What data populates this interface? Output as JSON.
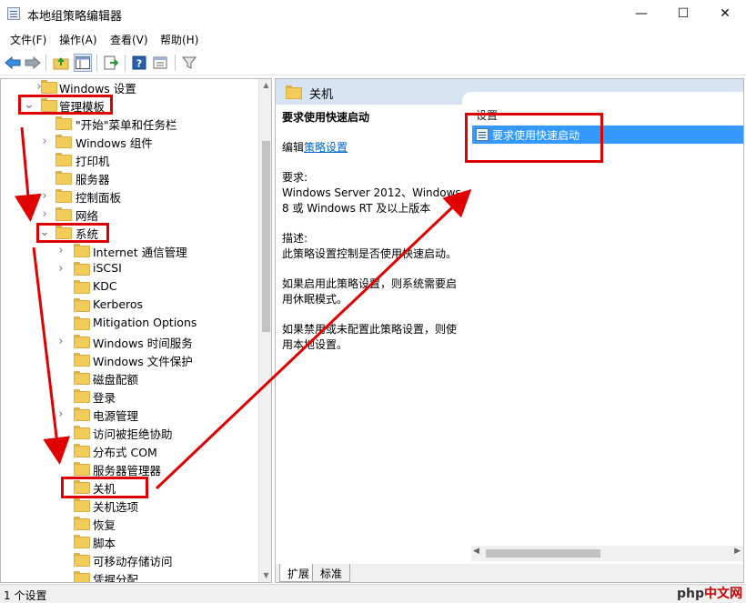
{
  "window": {
    "title": "本地组策略编辑器",
    "min_glyph": "—",
    "max_glyph": "☐",
    "close_glyph": "✕"
  },
  "menu": [
    "文件(F)",
    "操作(A)",
    "查看(V)",
    "帮助(H)"
  ],
  "toolbar_icons": [
    "back-arrow-icon",
    "forward-arrow-icon",
    "up-folder-icon",
    "show-hide-tree-icon",
    "export-list-icon",
    "help-icon",
    "properties-icon",
    "filter-icon"
  ],
  "tree": [
    {
      "label": "Windows 设置",
      "depth": 0,
      "expander": "closed"
    },
    {
      "label": "管理模板",
      "depth": 0,
      "expander": "open"
    },
    {
      "label": "\"开始\"菜单和任务栏",
      "depth": 1,
      "expander": "none"
    },
    {
      "label": "Windows 组件",
      "depth": 1,
      "expander": "closed"
    },
    {
      "label": "打印机",
      "depth": 1,
      "expander": "none"
    },
    {
      "label": "服务器",
      "depth": 1,
      "expander": "none"
    },
    {
      "label": "控制面板",
      "depth": 1,
      "expander": "closed"
    },
    {
      "label": "网络",
      "depth": 1,
      "expander": "closed"
    },
    {
      "label": "系统",
      "depth": 1,
      "expander": "open"
    },
    {
      "label": "Internet 通信管理",
      "depth": 2,
      "expander": "closed"
    },
    {
      "label": "iSCSI",
      "depth": 2,
      "expander": "closed"
    },
    {
      "label": "KDC",
      "depth": 2,
      "expander": "none"
    },
    {
      "label": "Kerberos",
      "depth": 2,
      "expander": "none"
    },
    {
      "label": "Mitigation Options",
      "depth": 2,
      "expander": "none"
    },
    {
      "label": "Windows 时间服务",
      "depth": 2,
      "expander": "closed"
    },
    {
      "label": "Windows 文件保护",
      "depth": 2,
      "expander": "none"
    },
    {
      "label": "磁盘配额",
      "depth": 2,
      "expander": "none"
    },
    {
      "label": "登录",
      "depth": 2,
      "expander": "none"
    },
    {
      "label": "电源管理",
      "depth": 2,
      "expander": "closed"
    },
    {
      "label": "访问被拒绝协助",
      "depth": 2,
      "expander": "none"
    },
    {
      "label": "分布式 COM",
      "depth": 2,
      "expander": "closed"
    },
    {
      "label": "服务器管理器",
      "depth": 2,
      "expander": "none"
    },
    {
      "label": "关机",
      "depth": 2,
      "expander": "none"
    },
    {
      "label": "关机选项",
      "depth": 2,
      "expander": "none"
    },
    {
      "label": "恢复",
      "depth": 2,
      "expander": "none"
    },
    {
      "label": "脚本",
      "depth": 2,
      "expander": "none"
    },
    {
      "label": "可移动存储访问",
      "depth": 2,
      "expander": "none"
    },
    {
      "label": "凭据分配",
      "depth": 2,
      "expander": "none"
    }
  ],
  "right": {
    "header": "关机",
    "desc_title": "要求使用快速启动",
    "edit_prefix": "编辑",
    "edit_link": "策略设置",
    "req_label": "要求:",
    "req_text": "Windows Server 2012、Windows 8 或 Windows RT 及以上版本",
    "desc_label": "描述:",
    "desc_text": "此策略设置控制是否使用快速启动。",
    "enabled_text": "如果启用此策略设置，则系统需要启用休眠模式。",
    "disabled_text": "如果禁用或未配置此策略设置，则使用本地设置。",
    "column_header": "设置",
    "list_items": [
      "要求使用快速启动"
    ]
  },
  "tabs": [
    "扩展",
    "标准"
  ],
  "status": "1 个设置",
  "watermark": {
    "a": "php",
    "b": "中文网"
  },
  "annotation_color": "#e00000",
  "selection_color": "#3399ff"
}
